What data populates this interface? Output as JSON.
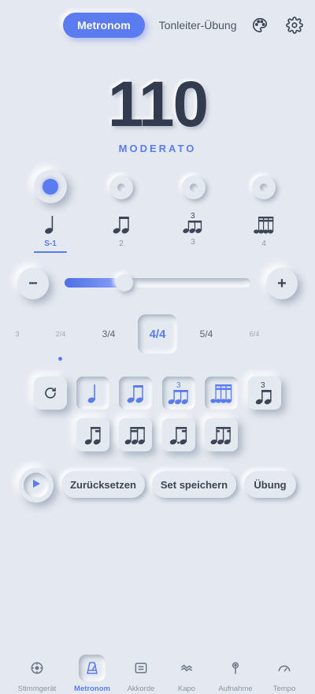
{
  "top": {
    "tabs": [
      {
        "label": "Metronom",
        "active": true
      },
      {
        "label": "Tonleiter-Übung",
        "active": false
      }
    ],
    "icons": [
      "palette-icon",
      "gear-icon"
    ]
  },
  "tempo": {
    "bpm": "110",
    "name": "MODERATO"
  },
  "beats": {
    "active_index": 0,
    "count": 4
  },
  "subdivisions": [
    {
      "label": "S-1",
      "active": true,
      "icon": "quarter-note-icon"
    },
    {
      "label": "2",
      "active": false,
      "icon": "eighth-notes-icon"
    },
    {
      "label": "3",
      "active": false,
      "icon": "triplet-icon",
      "tuplet": "3"
    },
    {
      "label": "4",
      "active": false,
      "icon": "sixteenth-notes-icon"
    }
  ],
  "slider": {
    "minus": "−",
    "plus": "+",
    "fraction": 0.32
  },
  "time_signatures": {
    "items": [
      "3",
      "2/4",
      "3/4",
      "4/4",
      "5/4",
      "6/4"
    ],
    "selected": "4/4"
  },
  "patterns": {
    "row1": [
      "repeat-icon",
      "quarter-note-icon",
      "eighth-notes-icon",
      "triplet-icon",
      "sixteenth-notes-icon",
      "triplet-eighths-icon"
    ],
    "row2": [
      "eighth-sixteenths-icon",
      "sixteenths-eighth-icon",
      "dotted-eighth-sixteenth-icon",
      "sixteenth-eighth-sixteenth-icon"
    ],
    "tuplet_label": "3"
  },
  "controls": {
    "reset": "Zurücksetzen",
    "save": "Set speichern",
    "exercise": "Übung"
  },
  "nav": [
    {
      "label": "Stimmgerät",
      "icon": "tuner-icon",
      "active": false
    },
    {
      "label": "Metronom",
      "icon": "metronome-icon",
      "active": true
    },
    {
      "label": "Akkorde",
      "icon": "chords-icon",
      "active": false
    },
    {
      "label": "Kapo",
      "icon": "capo-icon",
      "active": false
    },
    {
      "label": "Aufnahme",
      "icon": "microphone-icon",
      "active": false
    },
    {
      "label": "Tempo",
      "icon": "speedometer-icon",
      "active": false
    }
  ],
  "colors": {
    "accent": "#5b7cf0",
    "background": "#e4e8ef",
    "text": "#303a4d"
  }
}
